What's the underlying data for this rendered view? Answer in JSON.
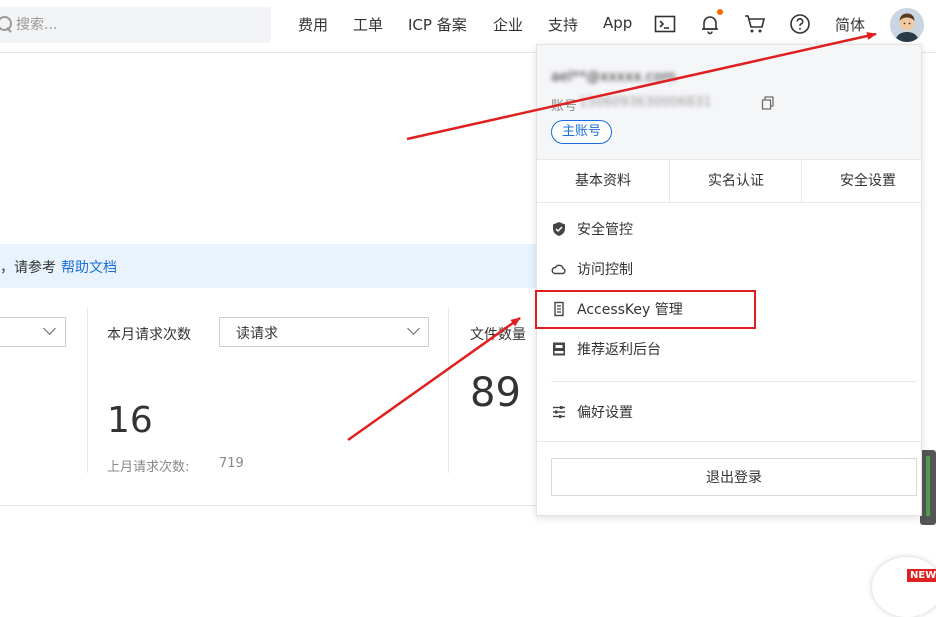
{
  "search": {
    "placeholder": "搜索..."
  },
  "nav": {
    "items": [
      "费用",
      "工单",
      "ICP 备案",
      "企业",
      "支持",
      "App"
    ],
    "lang": "简体",
    "icons": [
      "terminal-icon",
      "bell-icon",
      "cart-icon",
      "help-icon"
    ],
    "notification_dot_color": "#ff6a00"
  },
  "main": {
    "banner_prefix": "，请参考",
    "banner_link": "帮助文档",
    "stat2_label": "本月请求次数",
    "stat2_select": "读请求",
    "stat2_value": "16",
    "stat2_sub_label": "上月请求次数:",
    "stat2_sub_value": "719",
    "stat3_label": "文件数量",
    "stat3_value": "89"
  },
  "account": {
    "name": "ael**@xxxxx.com",
    "id_prefix": "账号",
    "id_value": "1506093630006831",
    "badge": "主账号"
  },
  "account_tabs": [
    "基本资料",
    "实名认证",
    "安全设置"
  ],
  "menu": {
    "security": "安全管控",
    "access": "访问控制",
    "accesskey": "AccessKey 管理",
    "referral": "推荐返利后台",
    "prefs": "偏好设置"
  },
  "logout": "退出登录",
  "corner_badge": "NEW",
  "colors": {
    "accent": "#1a6ed9",
    "annotation_red": "#e02020",
    "banner_bg": "#e8f3fd"
  }
}
